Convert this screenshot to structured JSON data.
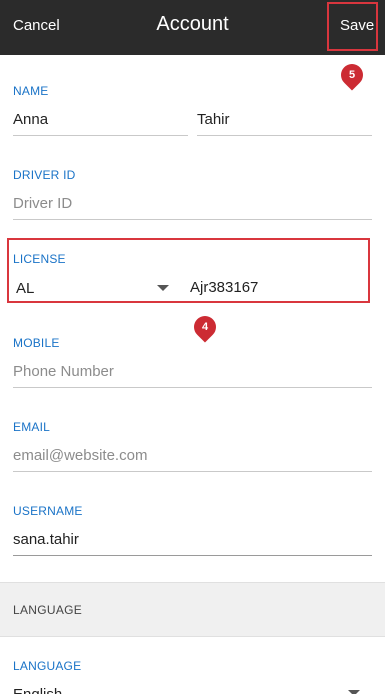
{
  "header": {
    "cancel_label": "Cancel",
    "title": "Account",
    "save_label": "Save",
    "save_badge": "5"
  },
  "name": {
    "label": "NAME",
    "first": "Anna",
    "last": "Tahir"
  },
  "driver_id": {
    "label": "DRIVER ID",
    "placeholder": "Driver ID"
  },
  "license": {
    "label": "LICENSE",
    "state": "AL",
    "number": "Ajr383167",
    "badge": "4"
  },
  "mobile": {
    "label": "MOBILE",
    "placeholder": "Phone Number"
  },
  "email": {
    "label": "EMAIL",
    "placeholder": "email@website.com"
  },
  "username": {
    "label": "USERNAME",
    "value": "sana.tahir"
  },
  "language_section": {
    "title": "LANGUAGE"
  },
  "language": {
    "label": "LANGUAGE",
    "value": "English"
  },
  "colors": {
    "topbar": "#2b2b2b",
    "accent_label": "#1a73c7",
    "highlight": "#d9363e"
  }
}
